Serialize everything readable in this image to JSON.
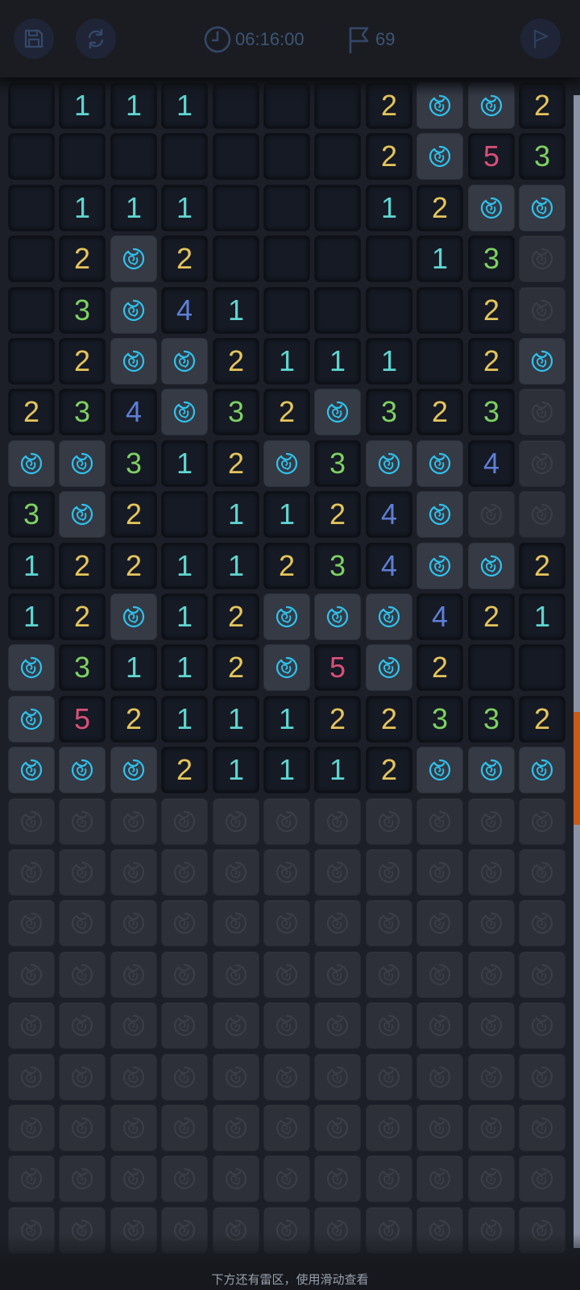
{
  "header": {
    "timer": "06:16:00",
    "flags": "69",
    "icons": {
      "save": "floppy-disk-icon",
      "restart": "restart-icon",
      "clock": "clock-icon",
      "flag": "flag-icon",
      "flag_mode": "flag-mode-icon"
    }
  },
  "board": {
    "columns": 11,
    "rows": [
      "_111___2MM2",
      "_______2M53",
      "_111___12MM",
      "_2M2____13#",
      "_3M41____2#",
      "_2MM2111_2M",
      "234M32M323#",
      "MM312M3MM4#",
      "3M2_1124M##",
      "12211234MM2",
      "12M12MMM421",
      "M3112M5M2__",
      "M5211122332",
      "MMM21112MMM",
      "###########",
      "###########",
      "###########",
      "###########",
      "###########",
      "###########",
      "###########",
      "###########",
      "###########"
    ],
    "legend": {
      "_": "revealed-empty",
      "digits": "revealed-number",
      "M": "revealed-mine",
      "#": "covered"
    },
    "number_colors": {
      "1": "#5fd6d0",
      "2": "#e5c55c",
      "3": "#7ed163",
      "4": "#5d7fd6",
      "5": "#d8507a"
    },
    "mine_color": "#2fc3ee",
    "covered_icon_color": "#3b3e46",
    "mine_icon": "rose-icon"
  },
  "footer": {
    "hint": "下方还有雷区，使用滑动查看"
  },
  "colors": {
    "background": "#1c1f27",
    "scrollbar_thumb": "#c95a18"
  }
}
